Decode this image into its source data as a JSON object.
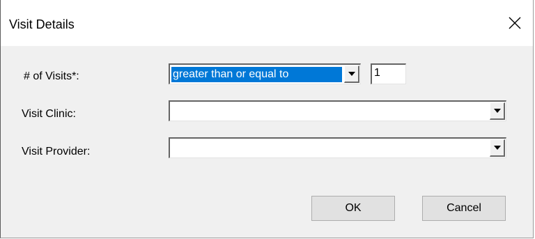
{
  "dialog": {
    "title": "Visit Details",
    "close_icon": "close-icon"
  },
  "form": {
    "visits": {
      "label": "# of Visits*:",
      "operator": "greater than or equal to",
      "count": "1"
    },
    "clinic": {
      "label": "Visit Clinic:",
      "value": ""
    },
    "provider": {
      "label": "Visit Provider:",
      "value": ""
    }
  },
  "buttons": {
    "ok": "OK",
    "cancel": "Cancel"
  },
  "colors": {
    "selection": "#0078d7",
    "client_bg": "#f0f0f0"
  }
}
